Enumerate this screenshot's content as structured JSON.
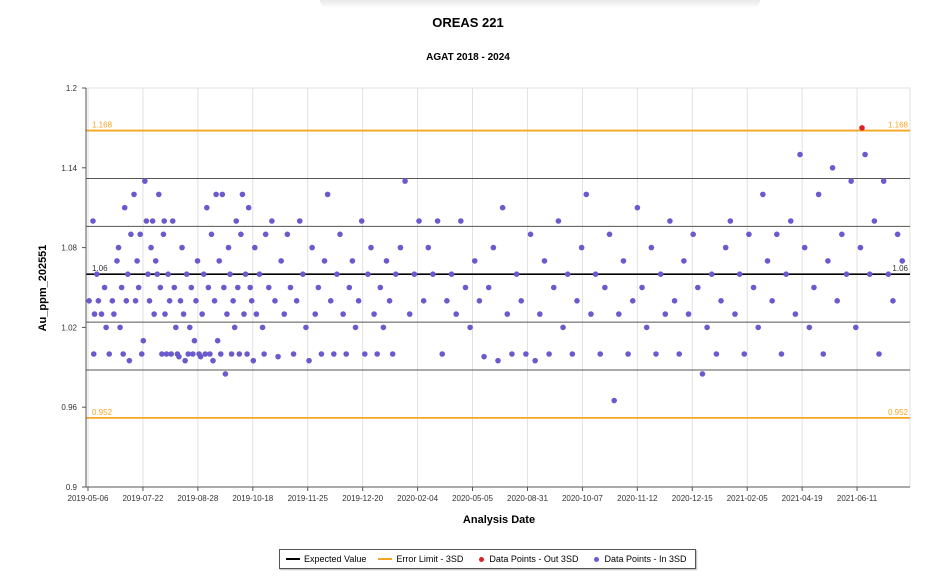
{
  "chart_data": {
    "type": "scatter",
    "title": "OREAS 221",
    "subtitle": "AGAT 2018 - 2024",
    "xlabel": "Analysis Date",
    "ylabel": "Au_ppm_202551",
    "ylim": [
      0.9,
      1.2
    ],
    "y_ticks": [
      "0.9",
      "0.96",
      "1.02",
      "1.08",
      "1.14",
      "1.2"
    ],
    "x_ticks": [
      "2019-05-06",
      "2019-07-22",
      "2019-08-28",
      "2019-10-18",
      "2019-11-25",
      "2019-12-20",
      "2020-02-04",
      "2020-05-05",
      "2020-08-31",
      "2020-10-07",
      "2020-11-12",
      "2020-12-15",
      "2021-02-05",
      "2021-04-19",
      "2021-06-11"
    ],
    "reference_lines": [
      {
        "name": "upper_3sd",
        "value": 1.168,
        "label": "1.168",
        "color": "#f5a623"
      },
      {
        "name": "upper_2sd",
        "value": 1.132,
        "label": "",
        "color": "#555555"
      },
      {
        "name": "upper_1sd",
        "value": 1.096,
        "label": "",
        "color": "#555555"
      },
      {
        "name": "expected",
        "value": 1.06,
        "label": "1.06",
        "color": "#000000"
      },
      {
        "name": "lower_1sd",
        "value": 1.024,
        "label": "",
        "color": "#555555"
      },
      {
        "name": "lower_2sd",
        "value": 0.988,
        "label": "",
        "color": "#555555"
      },
      {
        "name": "lower_3sd",
        "value": 0.952,
        "label": "0.952",
        "color": "#f5a623"
      }
    ],
    "series": [
      {
        "name": "Data Points - In 3SD",
        "color": "#6a5acd",
        "points": [
          [
            0.2,
            1.04
          ],
          [
            0.45,
            1.1
          ],
          [
            0.5,
            1.0
          ],
          [
            0.55,
            1.03
          ],
          [
            0.7,
            1.06
          ],
          [
            0.8,
            1.04
          ],
          [
            1.0,
            1.03
          ],
          [
            1.2,
            1.05
          ],
          [
            1.3,
            1.02
          ],
          [
            1.5,
            1.0
          ],
          [
            1.7,
            1.04
          ],
          [
            1.8,
            1.03
          ],
          [
            2.0,
            1.07
          ],
          [
            2.1,
            1.08
          ],
          [
            2.2,
            1.02
          ],
          [
            2.3,
            1.05
          ],
          [
            2.4,
            1.0
          ],
          [
            2.5,
            1.11
          ],
          [
            2.6,
            1.04
          ],
          [
            2.7,
            1.06
          ],
          [
            2.8,
            0.995
          ],
          [
            2.9,
            1.09
          ],
          [
            3.1,
            1.12
          ],
          [
            3.2,
            1.04
          ],
          [
            3.3,
            1.07
          ],
          [
            3.4,
            1.05
          ],
          [
            3.5,
            1.09
          ],
          [
            3.6,
            1.0
          ],
          [
            3.7,
            1.01
          ],
          [
            3.8,
            1.13
          ],
          [
            3.9,
            1.1
          ],
          [
            4.0,
            1.06
          ],
          [
            4.1,
            1.04
          ],
          [
            4.2,
            1.08
          ],
          [
            4.3,
            1.1
          ],
          [
            4.4,
            1.03
          ],
          [
            4.5,
            1.07
          ],
          [
            4.6,
            1.06
          ],
          [
            4.7,
            1.12
          ],
          [
            4.8,
            1.05
          ],
          [
            4.9,
            1.0
          ],
          [
            5.0,
            1.09
          ],
          [
            5.05,
            1.1
          ],
          [
            5.1,
            1.03
          ],
          [
            5.2,
            1.0
          ],
          [
            5.3,
            1.06
          ],
          [
            5.4,
            1.04
          ],
          [
            5.5,
            1.0
          ],
          [
            5.6,
            1.1
          ],
          [
            5.7,
            1.05
          ],
          [
            5.8,
            1.02
          ],
          [
            5.9,
            1.0
          ],
          [
            6.0,
            0.998
          ],
          [
            6.1,
            1.04
          ],
          [
            6.2,
            1.08
          ],
          [
            6.3,
            1.03
          ],
          [
            6.4,
            0.995
          ],
          [
            6.5,
            1.06
          ],
          [
            6.6,
            1.0
          ],
          [
            6.7,
            1.02
          ],
          [
            6.8,
            1.05
          ],
          [
            6.9,
            1.0
          ],
          [
            7.0,
            1.01
          ],
          [
            7.1,
            1.04
          ],
          [
            7.2,
            1.07
          ],
          [
            7.3,
            1.0
          ],
          [
            7.4,
            0.998
          ],
          [
            7.5,
            1.03
          ],
          [
            7.6,
            1.06
          ],
          [
            7.7,
            1.0
          ],
          [
            7.8,
            1.11
          ],
          [
            7.9,
            1.05
          ],
          [
            8.0,
            1.0
          ],
          [
            8.1,
            1.09
          ],
          [
            8.2,
            0.995
          ],
          [
            8.3,
            1.04
          ],
          [
            8.4,
            1.12
          ],
          [
            8.5,
            1.01
          ],
          [
            8.6,
            1.07
          ],
          [
            8.7,
            1.0
          ],
          [
            8.8,
            1.12
          ],
          [
            8.9,
            1.05
          ],
          [
            9.0,
            0.985
          ],
          [
            9.1,
            1.03
          ],
          [
            9.2,
            1.08
          ],
          [
            9.3,
            1.06
          ],
          [
            9.4,
            1.0
          ],
          [
            9.5,
            1.04
          ],
          [
            9.6,
            1.02
          ],
          [
            9.7,
            1.1
          ],
          [
            9.8,
            1.05
          ],
          [
            9.9,
            1.0
          ],
          [
            10.0,
            1.09
          ],
          [
            10.1,
            1.12
          ],
          [
            10.2,
            1.03
          ],
          [
            10.3,
            1.06
          ],
          [
            10.4,
            1.0
          ],
          [
            10.5,
            1.11
          ],
          [
            10.6,
            1.05
          ],
          [
            10.7,
            1.04
          ],
          [
            10.8,
            0.995
          ],
          [
            10.9,
            1.08
          ],
          [
            11.0,
            1.03
          ],
          [
            11.2,
            1.06
          ],
          [
            11.4,
            1.02
          ],
          [
            11.5,
            1.0
          ],
          [
            11.6,
            1.09
          ],
          [
            11.8,
            1.05
          ],
          [
            12.0,
            1.1
          ],
          [
            12.2,
            1.04
          ],
          [
            12.4,
            0.998
          ],
          [
            12.6,
            1.07
          ],
          [
            12.8,
            1.03
          ],
          [
            13.0,
            1.09
          ],
          [
            13.2,
            1.05
          ],
          [
            13.4,
            1.0
          ],
          [
            13.6,
            1.04
          ],
          [
            13.8,
            1.1
          ],
          [
            14.0,
            1.06
          ],
          [
            14.2,
            1.02
          ],
          [
            14.4,
            0.995
          ],
          [
            14.6,
            1.08
          ],
          [
            14.8,
            1.03
          ],
          [
            15.0,
            1.05
          ],
          [
            15.2,
            1.0
          ],
          [
            15.4,
            1.07
          ],
          [
            15.6,
            1.12
          ],
          [
            15.8,
            1.04
          ],
          [
            16.0,
            1.0
          ],
          [
            16.2,
            1.06
          ],
          [
            16.4,
            1.09
          ],
          [
            16.6,
            1.03
          ],
          [
            16.8,
            1.0
          ],
          [
            17.0,
            1.05
          ],
          [
            17.2,
            1.07
          ],
          [
            17.4,
            1.02
          ],
          [
            17.6,
            1.04
          ],
          [
            17.8,
            1.1
          ],
          [
            18.0,
            1.0
          ],
          [
            18.2,
            1.06
          ],
          [
            18.4,
            1.08
          ],
          [
            18.6,
            1.03
          ],
          [
            18.8,
            1.0
          ],
          [
            19.0,
            1.05
          ],
          [
            19.2,
            1.02
          ],
          [
            19.4,
            1.07
          ],
          [
            19.6,
            1.04
          ],
          [
            19.8,
            1.0
          ],
          [
            20.0,
            1.06
          ],
          [
            20.3,
            1.08
          ],
          [
            20.6,
            1.13
          ],
          [
            20.9,
            1.03
          ],
          [
            21.2,
            1.06
          ],
          [
            21.5,
            1.1
          ],
          [
            21.8,
            1.04
          ],
          [
            22.1,
            1.08
          ],
          [
            22.4,
            1.06
          ],
          [
            22.7,
            1.1
          ],
          [
            23.0,
            1.0
          ],
          [
            23.3,
            1.04
          ],
          [
            23.6,
            1.06
          ],
          [
            23.9,
            1.03
          ],
          [
            24.2,
            1.1
          ],
          [
            24.5,
            1.05
          ],
          [
            24.8,
            1.02
          ],
          [
            25.1,
            1.07
          ],
          [
            25.4,
            1.04
          ],
          [
            25.7,
            0.998
          ],
          [
            26.0,
            1.05
          ],
          [
            26.3,
            1.08
          ],
          [
            26.6,
            0.995
          ],
          [
            26.9,
            1.11
          ],
          [
            27.2,
            1.03
          ],
          [
            27.5,
            1.0
          ],
          [
            27.8,
            1.06
          ],
          [
            28.1,
            1.04
          ],
          [
            28.4,
            1.0
          ],
          [
            28.7,
            1.09
          ],
          [
            29.0,
            0.995
          ],
          [
            29.3,
            1.03
          ],
          [
            29.6,
            1.07
          ],
          [
            29.9,
            1.0
          ],
          [
            30.2,
            1.05
          ],
          [
            30.5,
            1.1
          ],
          [
            30.8,
            1.02
          ],
          [
            31.1,
            1.06
          ],
          [
            31.4,
            1.0
          ],
          [
            31.7,
            1.04
          ],
          [
            32.0,
            1.08
          ],
          [
            32.3,
            1.12
          ],
          [
            32.6,
            1.03
          ],
          [
            32.9,
            1.06
          ],
          [
            33.2,
            1.0
          ],
          [
            33.5,
            1.05
          ],
          [
            33.8,
            1.09
          ],
          [
            34.1,
            0.965
          ],
          [
            34.4,
            1.03
          ],
          [
            34.7,
            1.07
          ],
          [
            35.0,
            1.0
          ],
          [
            35.3,
            1.04
          ],
          [
            35.6,
            1.11
          ],
          [
            35.9,
            1.05
          ],
          [
            36.2,
            1.02
          ],
          [
            36.5,
            1.08
          ],
          [
            36.8,
            1.0
          ],
          [
            37.1,
            1.06
          ],
          [
            37.4,
            1.03
          ],
          [
            37.7,
            1.1
          ],
          [
            38.0,
            1.04
          ],
          [
            38.3,
            1.0
          ],
          [
            38.6,
            1.07
          ],
          [
            38.9,
            1.03
          ],
          [
            39.2,
            1.09
          ],
          [
            39.5,
            1.05
          ],
          [
            39.8,
            0.985
          ],
          [
            40.1,
            1.02
          ],
          [
            40.4,
            1.06
          ],
          [
            40.7,
            1.0
          ],
          [
            41.0,
            1.04
          ],
          [
            41.3,
            1.08
          ],
          [
            41.6,
            1.1
          ],
          [
            41.9,
            1.03
          ],
          [
            42.2,
            1.06
          ],
          [
            42.5,
            1.0
          ],
          [
            42.8,
            1.09
          ],
          [
            43.1,
            1.05
          ],
          [
            43.4,
            1.02
          ],
          [
            43.7,
            1.12
          ],
          [
            44.0,
            1.07
          ],
          [
            44.3,
            1.04
          ],
          [
            44.6,
            1.09
          ],
          [
            44.9,
            1.0
          ],
          [
            45.2,
            1.06
          ],
          [
            45.5,
            1.1
          ],
          [
            45.8,
            1.03
          ],
          [
            46.1,
            1.15
          ],
          [
            46.4,
            1.08
          ],
          [
            46.7,
            1.02
          ],
          [
            47.0,
            1.05
          ],
          [
            47.3,
            1.12
          ],
          [
            47.6,
            1.0
          ],
          [
            47.9,
            1.07
          ],
          [
            48.2,
            1.14
          ],
          [
            48.5,
            1.04
          ],
          [
            48.8,
            1.09
          ],
          [
            49.1,
            1.06
          ],
          [
            49.4,
            1.13
          ],
          [
            49.7,
            1.02
          ],
          [
            50.0,
            1.08
          ],
          [
            50.3,
            1.15
          ],
          [
            50.6,
            1.06
          ],
          [
            50.9,
            1.1
          ],
          [
            51.2,
            1.0
          ],
          [
            51.5,
            1.13
          ],
          [
            51.8,
            1.06
          ],
          [
            52.1,
            1.04
          ],
          [
            52.4,
            1.09
          ],
          [
            52.7,
            1.07
          ]
        ]
      },
      {
        "name": "Data Points - Out 3SD",
        "color": "#e02020",
        "points": [
          [
            50.1,
            1.17
          ]
        ]
      }
    ],
    "legend": {
      "placement": "bottom-center",
      "items": [
        "Expected Value",
        "Error Limit - 3SD",
        "Data Points - Out 3SD",
        "Data Points - In 3SD"
      ]
    },
    "grid": true
  },
  "legend_labels": {
    "expected": "Expected Value",
    "error": "Error Limit - 3SD",
    "out": "Data Points - Out 3SD",
    "in": "Data Points - In 3SD"
  },
  "colors": {
    "in_point": "#6a5acd",
    "out_point": "#e02020",
    "limit": "#f5a623",
    "expected": "#000000",
    "sd": "#555555"
  }
}
